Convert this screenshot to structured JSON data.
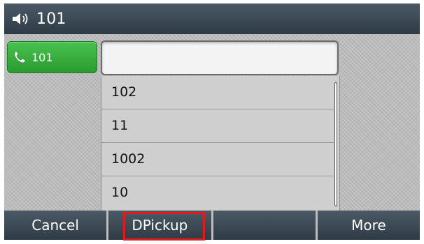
{
  "titlebar": {
    "icon": "speaker-icon",
    "title": "101"
  },
  "line_key": {
    "icon": "phone-icon",
    "label": "101",
    "color": "#35b03b"
  },
  "dial_input": {
    "value": ""
  },
  "suggestions": [
    {
      "label": "102"
    },
    {
      "label": "11"
    },
    {
      "label": "1002"
    },
    {
      "label": "10"
    }
  ],
  "softkeys": [
    {
      "label": "Cancel"
    },
    {
      "label": "DPickup",
      "highlighted": true
    },
    {
      "label": ""
    },
    {
      "label": "More"
    }
  ],
  "colors": {
    "titlebar": "#2f3b45",
    "highlight_border": "#e11a1a"
  }
}
